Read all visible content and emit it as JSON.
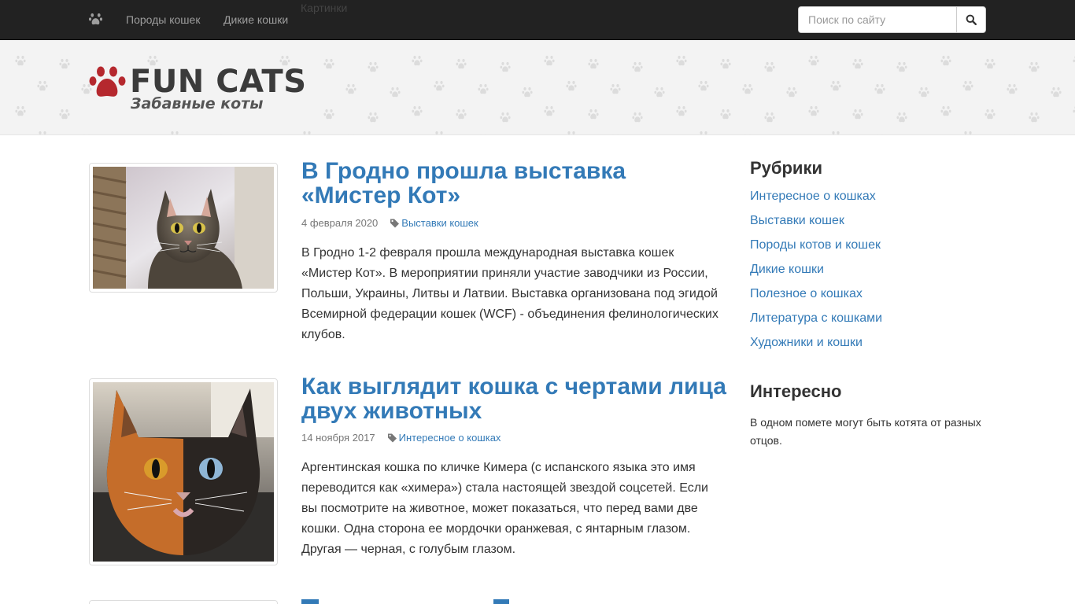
{
  "nav": {
    "home_icon": "paw-icon",
    "links": [
      "Породы кошек",
      "Дикие кошки",
      "Картинки"
    ],
    "search_placeholder": "Поиск по сайту",
    "search_icon": "search-icon"
  },
  "logo": {
    "title": "FUN CATS",
    "subtitle": "Забавные коты",
    "paw_color": "#b5282e"
  },
  "posts": [
    {
      "title": "В Гродно прошла выставка «Мистер Кот»",
      "date": "4 февраля 2020",
      "category": "Выставки кошек",
      "excerpt": "В Гродно 1-2 февраля прошла международная выставка кошек «Мистер Кот». В мероприятии приняли участие заводчики из России, Польши, Украины, Литвы и Латвии. Выставка организована под эгидой Всемирной федерации кошек (WCF) - объединения фелинологических клубов."
    },
    {
      "title": "Как выглядит кошка с чертами лица двух животных",
      "date": "14 ноября 2017",
      "category": "Интересное о кошках",
      "excerpt": "Аргентинская кошка по кличке Кимера (с испанского языка это имя переводится как «химера») стала настоящей звездой соцсетей. Если вы посмотрите на животное, может показаться, что перед вами две кошки. Одна сторона ее мордочки оранжевая, с янтарным глазом. Другая — черная, с голубым глазом."
    }
  ],
  "sidebar": {
    "categories_title": "Рубрики",
    "categories": [
      "Интересное о кошках",
      "Выставки кошек",
      "Породы котов и кошек",
      "Дикие кошки",
      "Полезное о кошках",
      "Литература с кошками",
      "Художники и кошки"
    ],
    "interesting_title": "Интересно",
    "interesting_text": "В одном помете могут быть котята от разных отцов."
  },
  "colors": {
    "navbar": "#222222",
    "link": "#337ab7",
    "header_bg": "#f3f3f3"
  }
}
